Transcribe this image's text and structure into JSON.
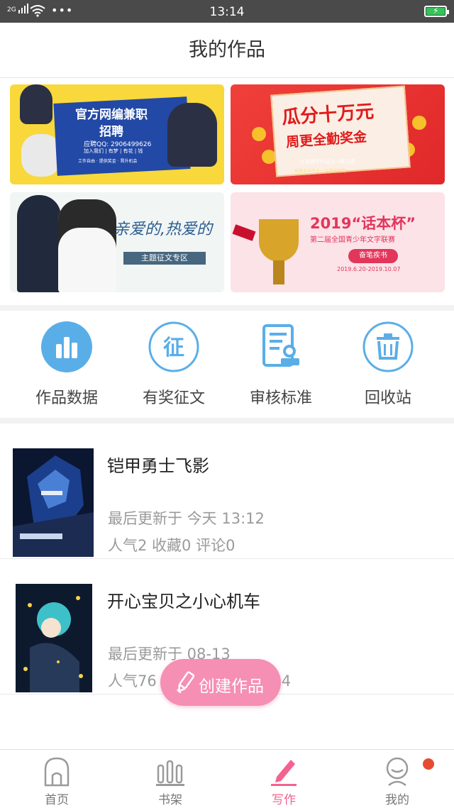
{
  "status_bar": {
    "network": "2G",
    "dots": "•••",
    "time": "13:14"
  },
  "header": {
    "title": "我的作品"
  },
  "banners": {
    "b1": {
      "line1": "官方网编兼职",
      "line2": "招聘",
      "line3": "应聘QQ: 2906499626",
      "line4": "加入我们 | 有梦 | 有花 | 钱",
      "line5": "工作自由  ·  提供奖金  ·  晋升机会"
    },
    "b2": {
      "line1": "瓜分十万元",
      "line2": "周更全勤奖金",
      "line3": "让坚持写作成为一种习惯",
      "line4": "每周五中午十一点准时开奖！"
    },
    "b3": {
      "line1": "亲爱的,热爱的",
      "tag": "主题征文专区"
    },
    "b4": {
      "line1": "2019“话本杯”",
      "line2": "第二届全国青少年文字联赛",
      "pill": "奋笔疾书",
      "dates": "2019.6.20-2019.10.07"
    }
  },
  "quick_actions": [
    {
      "label": "作品数据",
      "icon": "bar-chart-icon"
    },
    {
      "label": "有奖征文",
      "icon": "contest-icon"
    },
    {
      "label": "审核标准",
      "icon": "review-doc-icon"
    },
    {
      "label": "回收站",
      "icon": "trash-icon"
    }
  ],
  "works": [
    {
      "title": "铠甲勇士飞影",
      "updated": "最后更新于 今天 13:12",
      "stats": "人气2 收藏0 评论0"
    },
    {
      "title": "开心宝贝之小心机车",
      "updated": "最后更新于 08-13",
      "stats_left": "人气76",
      "stats_right": "4"
    }
  ],
  "fab": {
    "label": "创建作品",
    "icon": "pencil-icon"
  },
  "tabs": [
    {
      "label": "首页",
      "icon": "home-icon"
    },
    {
      "label": "书架",
      "icon": "bookshelf-icon"
    },
    {
      "label": "写作",
      "icon": "write-icon",
      "active": true
    },
    {
      "label": "我的",
      "icon": "profile-icon"
    }
  ],
  "colors": {
    "accent": "#f2638f",
    "fab": "#f58fb4",
    "icon_blue": "#5aaee8",
    "notification": "#e54b32"
  }
}
